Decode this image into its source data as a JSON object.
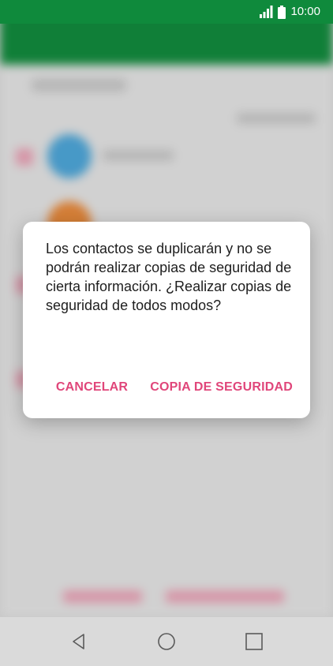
{
  "status_bar": {
    "time": "10:00",
    "icons": [
      "signal-icon",
      "battery-icon"
    ]
  },
  "dialog": {
    "message": "Los contactos se duplicarán y no se podrán realizar copias de seguridad de cierta información. ¿Realizar copias de seguridad de todos modos?",
    "cancel_label": "CANCELAR",
    "confirm_label": "COPIA DE SEGURIDAD"
  },
  "navigation": {
    "icons": [
      "back-icon",
      "home-icon",
      "recents-icon"
    ]
  },
  "colors": {
    "status_bar": "#0f8a3c",
    "accent": "#e0467a"
  }
}
